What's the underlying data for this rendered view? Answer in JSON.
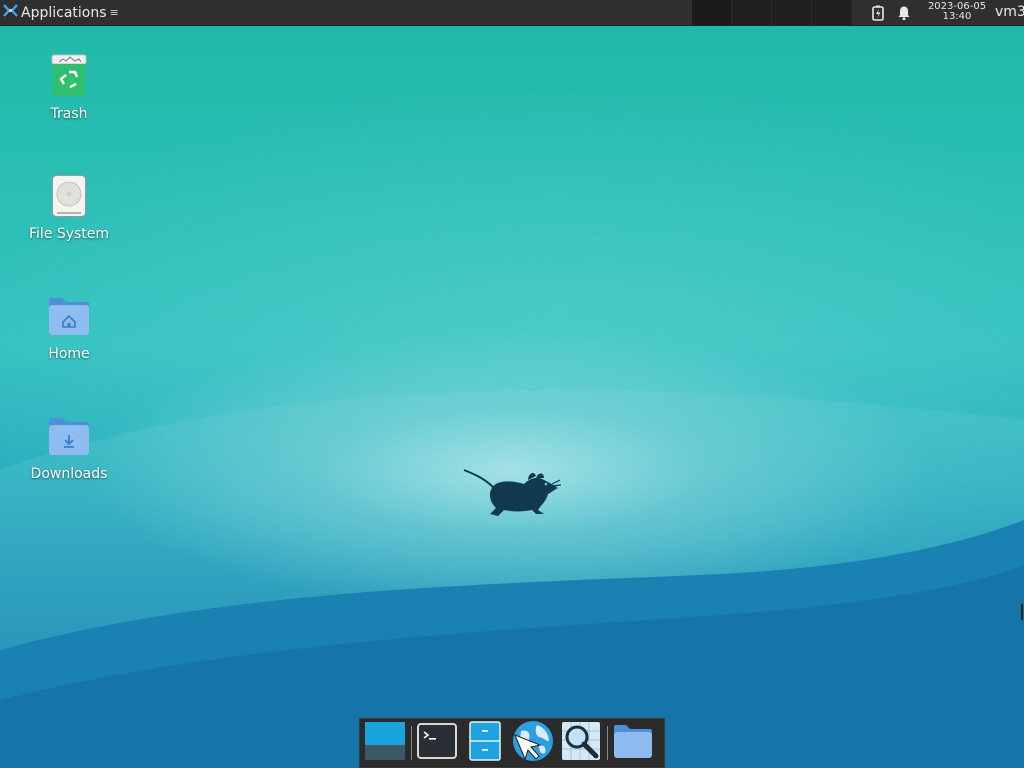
{
  "panel": {
    "applications_label": "Applications",
    "menu_glyph": "≡",
    "clock_date": "2023-06-05",
    "clock_time": "13:40",
    "user_label": "vm3",
    "tray_icons": [
      "battery-icon",
      "notification-bell-icon"
    ],
    "workspaces": 4
  },
  "desktop": {
    "icons": [
      {
        "label": "Trash",
        "icon": "trash-icon"
      },
      {
        "label": "File System",
        "icon": "drive-icon"
      },
      {
        "label": "Home",
        "icon": "home-folder-icon"
      },
      {
        "label": "Downloads",
        "icon": "downloads-folder-icon"
      }
    ]
  },
  "dock": {
    "items": [
      {
        "name": "show-desktop",
        "icon": "show-desktop-icon"
      },
      {
        "name": "terminal",
        "icon": "terminal-icon"
      },
      {
        "name": "file-manager",
        "icon": "file-manager-icon"
      },
      {
        "name": "web-browser",
        "icon": "web-browser-icon"
      },
      {
        "name": "app-finder",
        "icon": "search-icon"
      },
      {
        "name": "folder",
        "icon": "folder-icon"
      }
    ]
  },
  "colors": {
    "panel_bg": "#2f2f2f",
    "desktop_top": "#1fb7a5",
    "desktop_bottom": "#1378aa",
    "folder_blue": "#6aa7e6"
  }
}
